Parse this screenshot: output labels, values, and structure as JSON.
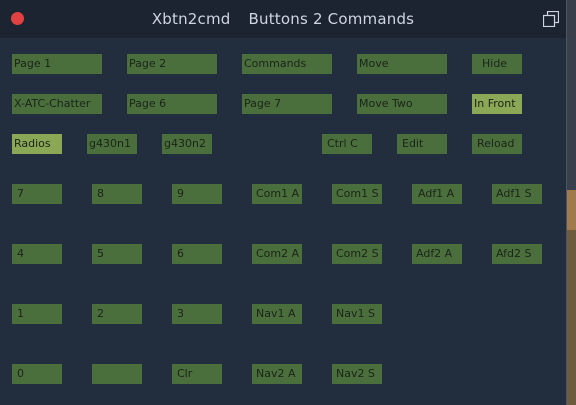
{
  "window": {
    "title_left": "Xbtn2cmd",
    "title_right": "Buttons 2 Commands"
  },
  "icons": {
    "close": "close-dot-icon",
    "maximize": "maximize-icon"
  },
  "colors": {
    "window_bg": "#222d3d",
    "titlebar_bg": "#1c2432",
    "button_bg": "#4a6f3c",
    "button_highlight_bg": "#8aa856",
    "close_red": "#e04141"
  },
  "buttons": {
    "page1": "Page 1",
    "page2": "Page 2",
    "commands": "Commands",
    "move": "Move",
    "hide": "Hide",
    "xatc": "X-ATC-Chatter",
    "page6": "Page 6",
    "page7": "Page 7",
    "move_two": "Move Two",
    "in_front": "In Front",
    "radios": "Radios",
    "g430n1": "g430n1",
    "g430n2": "g430n2",
    "ctrlc": "Ctrl C",
    "edit": "Edit",
    "reload": "Reload",
    "k7": "7",
    "k8": "8",
    "k9": "9",
    "com1a": "Com1 A",
    "com1s": "Com1 S",
    "adf1a": "Adf1 A",
    "adf1s": "Adf1 S",
    "k4": "4",
    "k5": "5",
    "k6": "6",
    "com2a": "Com2 A",
    "com2s": "Com2 S",
    "adf2a": "Adf2 A",
    "afd2s": "Afd2 S",
    "k1": "1",
    "k2": "2",
    "k3": "3",
    "nav1a": "Nav1 A",
    "nav1s": "Nav1 S",
    "k0": "0",
    "blank": "",
    "clr": "Clr",
    "nav2a": "Nav2 A",
    "nav2s": "Nav2 S"
  }
}
